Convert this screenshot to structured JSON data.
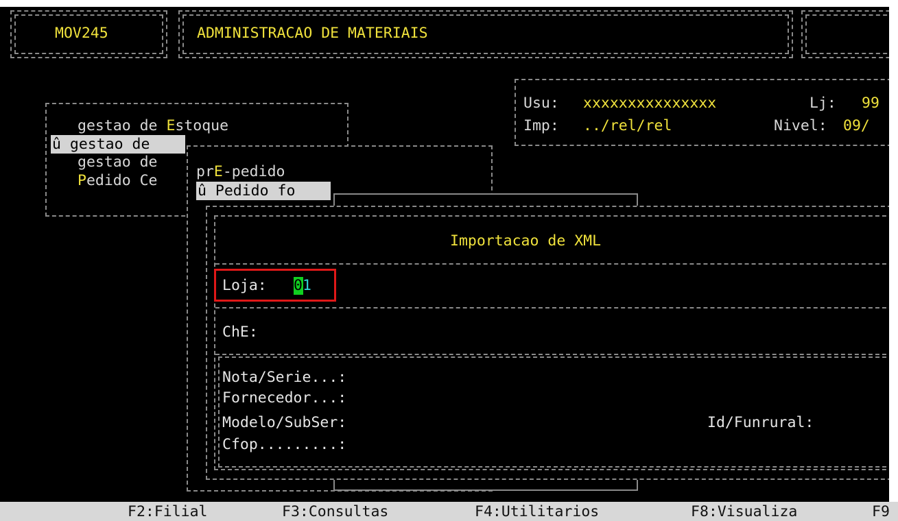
{
  "header": {
    "program_code": "MOV245",
    "system_title": "ADMINISTRACAO DE MATERIAIS"
  },
  "user_info": {
    "usu_label": "Usu:",
    "usu_value": "xxxxxxxxxxxxxxx",
    "lj_label": "Lj:",
    "lj_value": "99",
    "imp_label": "Imp:",
    "imp_value": "../rel/rel",
    "nivel_label": "Nivel:",
    "nivel_value": "09/"
  },
  "main_menu": {
    "items": [
      {
        "prefix": "gestao de ",
        "hotkey": "E",
        "rest": "stoque"
      },
      {
        "marker": "û",
        "label": "gestao de"
      },
      {
        "label": "gestao de"
      },
      {
        "hotkey": "P",
        "rest": "edido Ce"
      }
    ]
  },
  "submenu": {
    "items": [
      {
        "prefix": "pr",
        "hotkey": "E",
        "rest": "-pedido"
      },
      {
        "marker": "û",
        "label": "Pedido fo"
      }
    ]
  },
  "dialog": {
    "title": "Importacao de XML",
    "loja_label": "Loja:",
    "loja_value_first": "0",
    "loja_value_rest": "1",
    "che_label": "ChE:",
    "fields": {
      "nota_serie": "Nota/Serie...:",
      "fornecedor": "Fornecedor...:",
      "modelo_subser": "Modelo/SubSer:",
      "cfop": "Cfop.........:",
      "id_funrural": "Id/Funrural:"
    }
  },
  "function_keys": [
    {
      "label": "F2:Filial"
    },
    {
      "label": "F3:Consultas"
    },
    {
      "label": "F4:Utilitarios"
    },
    {
      "label": "F8:Visualiza"
    },
    {
      "label": "F9"
    }
  ]
}
